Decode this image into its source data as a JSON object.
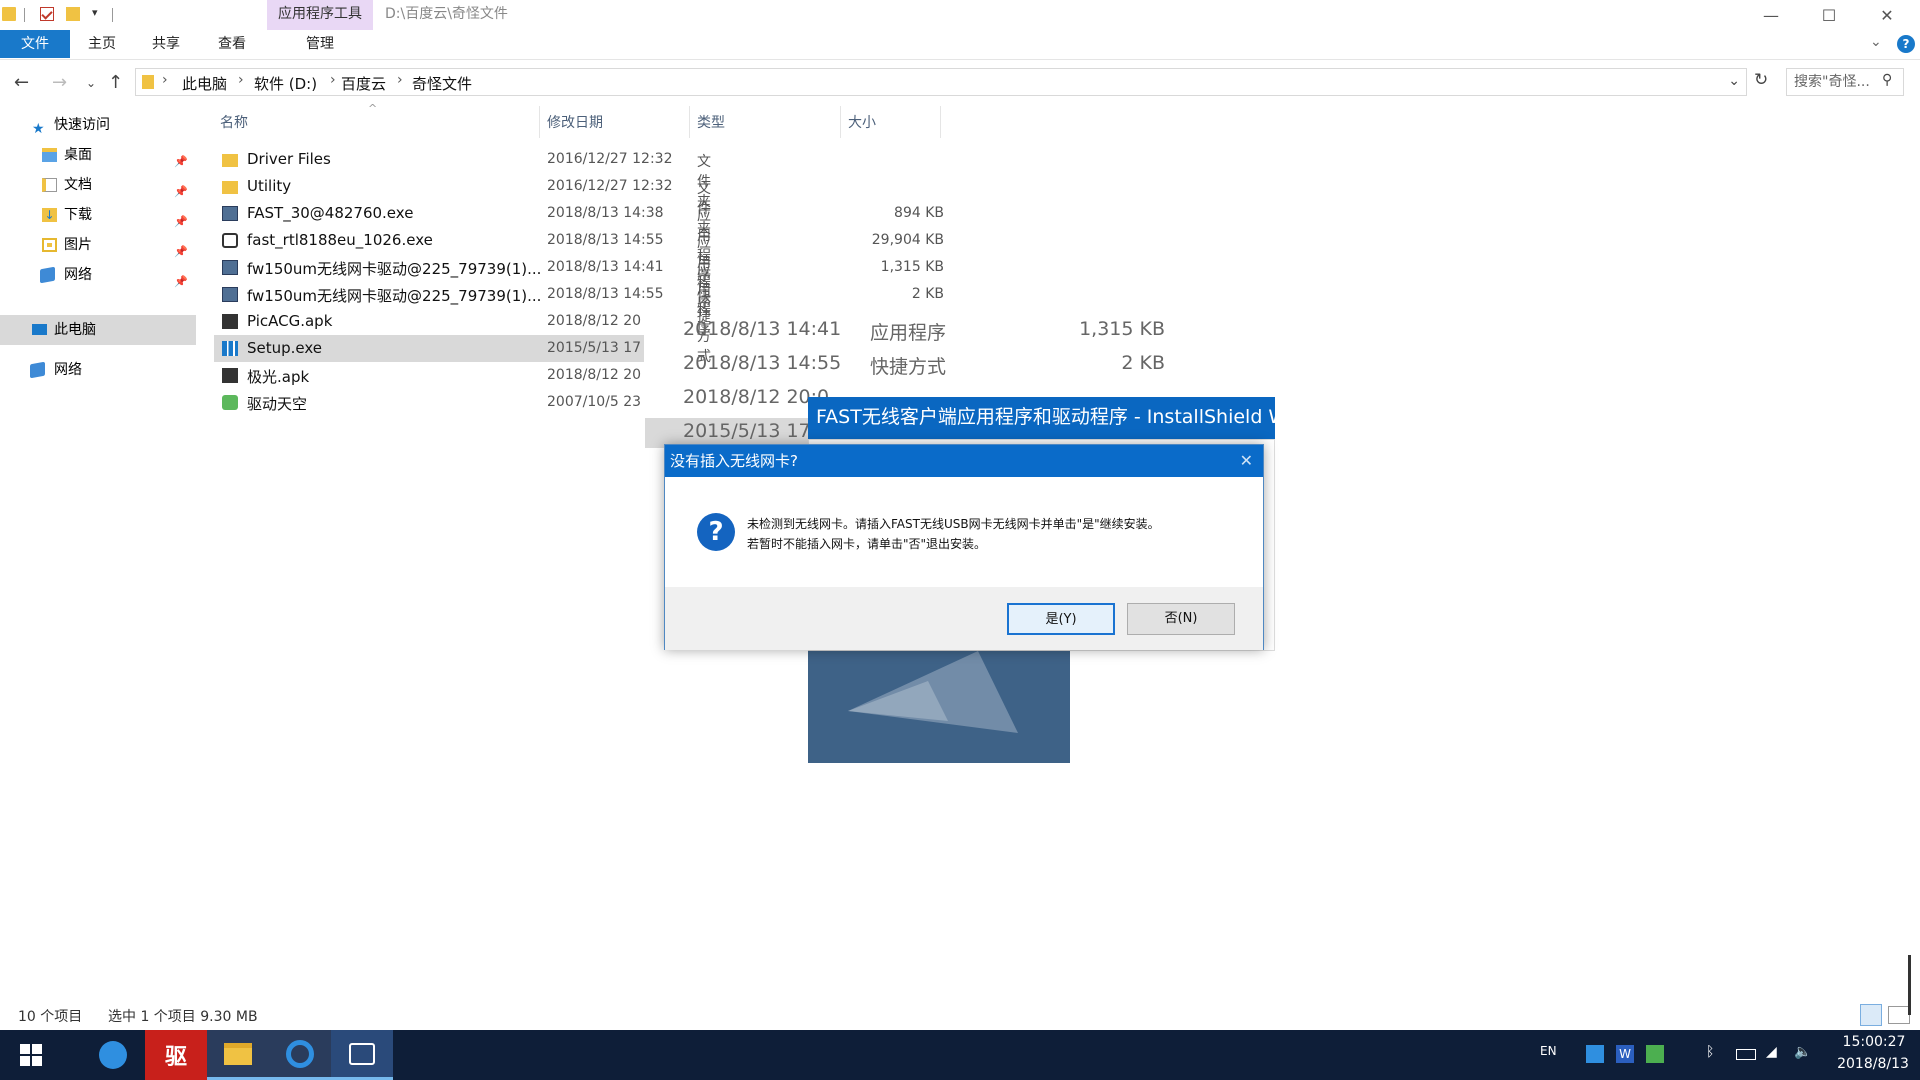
{
  "window": {
    "context_tab": "应用程序工具",
    "path": "D:\\百度云\\奇怪文件",
    "controls": {
      "minimize": "—",
      "maximize": "☐",
      "close": "✕"
    }
  },
  "ribbon": {
    "tabs": [
      "文件",
      "主页",
      "共享",
      "查看",
      "管理"
    ]
  },
  "address": {
    "crumbs": [
      "此电脑",
      "软件 (D:)",
      "百度云",
      "奇怪文件"
    ],
    "search_placeholder": "搜索\"奇怪..."
  },
  "nav": {
    "quick_access": "快速访问",
    "items": [
      "桌面",
      "文档",
      "下载",
      "图片",
      "网络"
    ],
    "this_pc": "此电脑",
    "network": "网络"
  },
  "columns": [
    "名称",
    "修改日期",
    "类型",
    "大小"
  ],
  "files": [
    {
      "name": "Driver Files",
      "date": "2016/12/27 12:32",
      "type": "文件夹",
      "size": "",
      "icon": "folder-icon"
    },
    {
      "name": "Utility",
      "date": "2016/12/27 12:32",
      "type": "文件夹",
      "size": "",
      "icon": "folder-icon"
    },
    {
      "name": "FAST_30@482760.exe",
      "date": "2018/8/13 14:38",
      "type": "应用程序",
      "size": "894 KB",
      "icon": "installer-icon"
    },
    {
      "name": "fast_rtl8188eu_1026.exe",
      "date": "2018/8/13 14:55",
      "type": "应用程序",
      "size": "29,904 KB",
      "icon": "setup-disc-icon"
    },
    {
      "name": "fw150um无线网卡驱动@225_79739(1)...",
      "date": "2018/8/13 14:41",
      "type": "应用程序",
      "size": "1,315 KB",
      "icon": "installer-icon"
    },
    {
      "name": "fw150um无线网卡驱动@225_79739(1)...",
      "date": "2018/8/13 14:55",
      "type": "快捷方式",
      "size": "2 KB",
      "icon": "installer-icon"
    },
    {
      "name": "PicACG.apk",
      "date": "2018/8/12 20",
      "type": "",
      "size": "",
      "icon": "apk-icon"
    },
    {
      "name": "Setup.exe",
      "date": "2015/5/13 17",
      "type": "",
      "size": "",
      "icon": "setup-chart-icon"
    },
    {
      "name": "极光.apk",
      "date": "2018/8/12 20",
      "type": "",
      "size": "",
      "icon": "apk-icon"
    },
    {
      "name": "驱动天空",
      "date": "2007/10/5 23",
      "type": "",
      "size": "",
      "icon": "shortcut-icon"
    }
  ],
  "ghost_rows": [
    {
      "date": "2018/8/13 14:41",
      "type": "应用程序",
      "size": "1,315 KB"
    },
    {
      "date": "2018/8/13 14:55",
      "type": "快捷方式",
      "size": "2 KB"
    },
    {
      "date": "2018/8/12 20:0",
      "type": "",
      "size": ""
    },
    {
      "date": "2015/5/13 17",
      "type": "",
      "size": ""
    }
  ],
  "installshield": {
    "title": "FAST无线客户端应用程序和驱动程序 - InstallShield W"
  },
  "dialog": {
    "title": "没有插入无线网卡?",
    "line1": "未检测到无线网卡。请插入FAST无线USB网卡无线网卡并单击\"是\"继续安装。",
    "line2": "若暂时不能插入网卡，请单击\"否\"退出安装。",
    "yes": "是(Y)",
    "no": "否(N)"
  },
  "status": {
    "count": "10 个项目",
    "selected": "选中 1 个项目  9.30 MB"
  },
  "taskbar": {
    "lang": "EN",
    "time": "15:00:27",
    "date": "2018/8/13"
  }
}
